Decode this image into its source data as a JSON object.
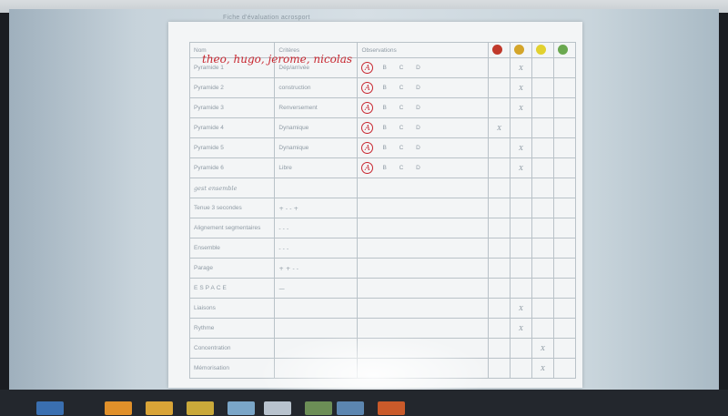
{
  "window": {
    "title": "Fiche d'évaluation acrosport"
  },
  "handwriting": {
    "names": "theo, hugo, jerome, nicolas",
    "gest_note": "gest ensemble",
    "space_label": "ESPACE"
  },
  "table": {
    "headers": {
      "name": "Nom",
      "criteria": "Critères",
      "observations": "Observations"
    },
    "level_colors": [
      "#c0392b",
      "#d4a52a",
      "#e2d12f",
      "#6aa84f"
    ],
    "rows": [
      {
        "name": "Pyramide 1",
        "criteria": "Dép/arrivée",
        "circle": "A",
        "letters": "B C D",
        "mark": "X",
        "mark_col": 1
      },
      {
        "name": "Pyramide 2",
        "criteria": "construction",
        "circle": "A",
        "letters": "B C D",
        "mark": "X",
        "mark_col": 1
      },
      {
        "name": "Pyramide 3",
        "criteria": "Renversement",
        "circle": "A",
        "letters": "B C D",
        "mark": "X",
        "mark_col": 1
      },
      {
        "name": "Pyramide 4",
        "criteria": "Dynamique",
        "circle": "A",
        "letters": "B C D",
        "mark": "X",
        "mark_col": 0
      },
      {
        "name": "Pyramide 5",
        "criteria": "Dynamique",
        "circle": "A",
        "letters": "B C D",
        "mark": "X",
        "mark_col": 1
      },
      {
        "name": "Pyramide 6",
        "criteria": "Libre",
        "circle": "A",
        "letters": "B C D",
        "mark": "X",
        "mark_col": 1
      },
      {
        "name": "",
        "criteria": "",
        "circle": "",
        "letters": "",
        "mark": "",
        "mark_col": -1
      },
      {
        "name": "Tenue 3 secondes",
        "criteria": "+ - - +",
        "circle": "",
        "letters": "",
        "mark": "",
        "mark_col": -1
      },
      {
        "name": "Alignement segmentaires",
        "criteria": "- - -",
        "circle": "",
        "letters": "",
        "mark": "",
        "mark_col": -1
      },
      {
        "name": "Ensemble",
        "criteria": "- - -",
        "circle": "",
        "letters": "",
        "mark": "",
        "mark_col": -1
      },
      {
        "name": "Parage",
        "criteria": "+ + - -",
        "circle": "",
        "letters": "",
        "mark": "",
        "mark_col": -1
      },
      {
        "name": "",
        "criteria": "—",
        "circle": "",
        "letters": "",
        "mark": "",
        "mark_col": -1
      },
      {
        "name": "Liaisons",
        "criteria": "",
        "circle": "",
        "letters": "",
        "mark": "X",
        "mark_col": 1
      },
      {
        "name": "Rythme",
        "criteria": "",
        "circle": "",
        "letters": "",
        "mark": "X",
        "mark_col": 1
      },
      {
        "name": "Concentration",
        "criteria": "",
        "circle": "",
        "letters": "",
        "mark": "X",
        "mark_col": 2
      },
      {
        "name": "Mémorisation",
        "criteria": "",
        "circle": "",
        "letters": "",
        "mark": "X",
        "mark_col": 2
      }
    ]
  },
  "taskbar": {
    "colors": [
      "#3a6fb0",
      "#e0902a",
      "#d9a437",
      "#c9a93a",
      "#7aa6c8",
      "#b8c3ce",
      "#6c8e56",
      "#5c86b0",
      "#c95a2a"
    ]
  }
}
